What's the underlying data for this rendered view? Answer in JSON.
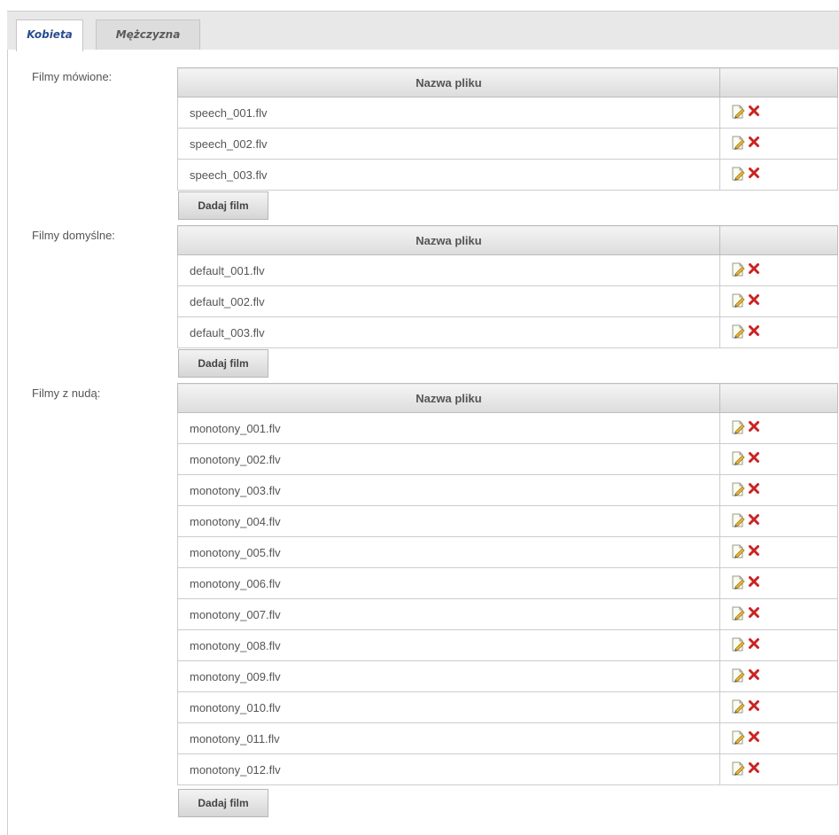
{
  "tabs": [
    {
      "label": "Kobieta",
      "active": true
    },
    {
      "label": "Mężczyzna",
      "active": false
    }
  ],
  "sections": [
    {
      "label": "Filmy mówione:",
      "column_header": "Nazwa pliku",
      "files": [
        "speech_001.flv",
        "speech_002.flv",
        "speech_003.flv"
      ],
      "add_button": "Dadaj film"
    },
    {
      "label": "Filmy domyślne:",
      "column_header": "Nazwa pliku",
      "files": [
        "default_001.flv",
        "default_002.flv",
        "default_003.flv"
      ],
      "add_button": "Dadaj film"
    },
    {
      "label": "Filmy z nudą:",
      "column_header": "Nazwa pliku",
      "files": [
        "monotony_001.flv",
        "monotony_002.flv",
        "monotony_003.flv",
        "monotony_004.flv",
        "monotony_005.flv",
        "monotony_006.flv",
        "monotony_007.flv",
        "monotony_008.flv",
        "monotony_009.flv",
        "monotony_010.flv",
        "monotony_011.flv",
        "monotony_012.flv"
      ],
      "add_button": "Dadaj film"
    }
  ],
  "row_actions": {
    "edit_icon": "edit-icon",
    "delete_icon": "delete-icon"
  },
  "colors": {
    "active_tab_text": "#2a4d8f",
    "delete_icon": "#cc2222",
    "tabbar_bg": "#e8e8e8"
  }
}
